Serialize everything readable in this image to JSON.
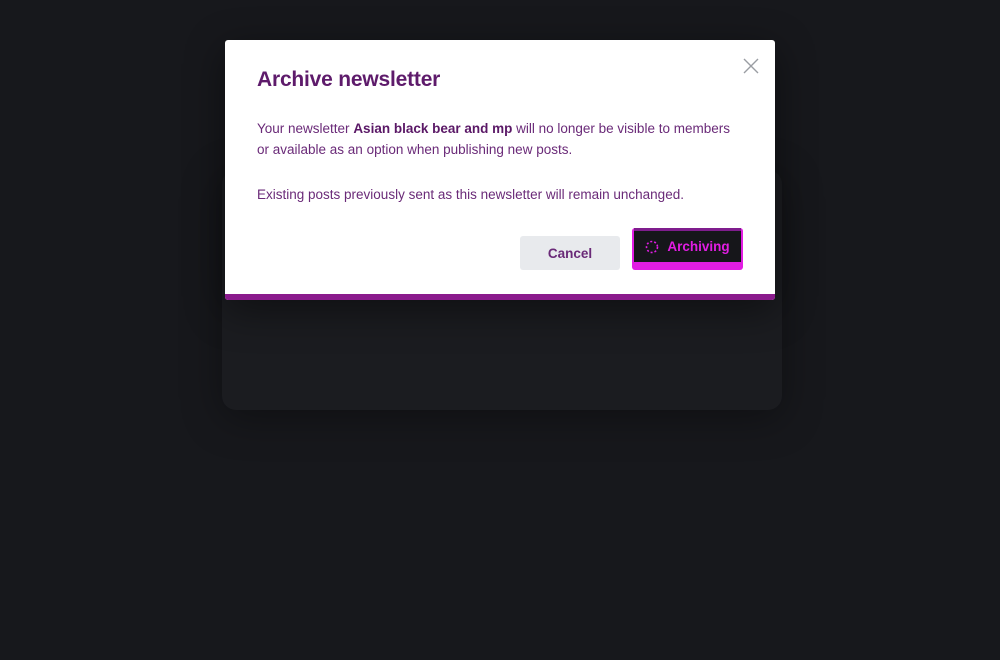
{
  "modal": {
    "title": "Archive newsletter",
    "body_prefix": "Your newsletter ",
    "newsletter_name": "Asian black bear and mp",
    "body_suffix": " will no longer be visible to members or available as an option when publishing new posts.",
    "existing_posts_note": "Existing posts previously sent as this newsletter will remain unchanged.",
    "cancel_label": "Cancel",
    "confirm_label": "Archiving",
    "close_icon": "close-icon",
    "spinner_icon": "spinner-icon"
  },
  "colors": {
    "backdrop": "#17181c",
    "modal_bg": "#ffffff",
    "accent": "#e21de3",
    "accent_dark": "#8a1a8c",
    "title": "#5e1b6b",
    "text": "#6a2a78",
    "cancel_bg": "#e8eaed",
    "button_dark": "#16161a"
  }
}
